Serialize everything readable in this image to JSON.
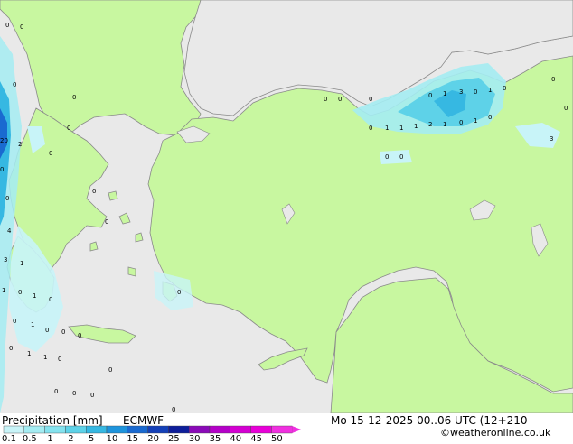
{
  "map": {
    "point_labels": [
      "0",
      "0",
      "0",
      "0",
      "0",
      "0",
      "0",
      "0",
      "1",
      "3",
      "0",
      "1",
      "0",
      "0",
      "0",
      "1",
      "1",
      "1",
      "2",
      "1",
      "0",
      "1",
      "0",
      "0",
      "0",
      "0",
      "3",
      "0",
      "0",
      "0",
      "20",
      "2",
      "0",
      "4",
      "0",
      "0",
      "3",
      "1",
      "1",
      "0",
      "1",
      "0",
      "0",
      "0",
      "1",
      "0",
      "0",
      "0",
      "0",
      "1",
      "1",
      "0",
      "0",
      "0",
      "0",
      "0",
      "0",
      "0",
      "0",
      "0",
      "0",
      "0",
      "0",
      "0",
      "0",
      "0",
      "0",
      "0",
      "0",
      "0",
      "0",
      "0",
      "1",
      "0",
      "0",
      "0",
      "0"
    ]
  },
  "footer": {
    "title": "Precipitation [mm]",
    "model": "ECMWF",
    "valid_time": "Mo 15-12-2025 00..06 UTC (12+210",
    "credit": "©weatheronline.co.uk",
    "legend_ticks": [
      "0.1",
      "0.5",
      "1",
      "2",
      "5",
      "10",
      "15",
      "20",
      "25",
      "30",
      "35",
      "40",
      "45",
      "50"
    ],
    "legend_colors": [
      "#c8f4f8",
      "#a4ecf2",
      "#84e2ee",
      "#5ed2e8",
      "#36b8e2",
      "#1e94dc",
      "#1a6ad0",
      "#1440b8",
      "#0e1e9a",
      "#8a0ab8",
      "#b400c8",
      "#d400d2",
      "#e800d8",
      "#f030e0"
    ]
  }
}
